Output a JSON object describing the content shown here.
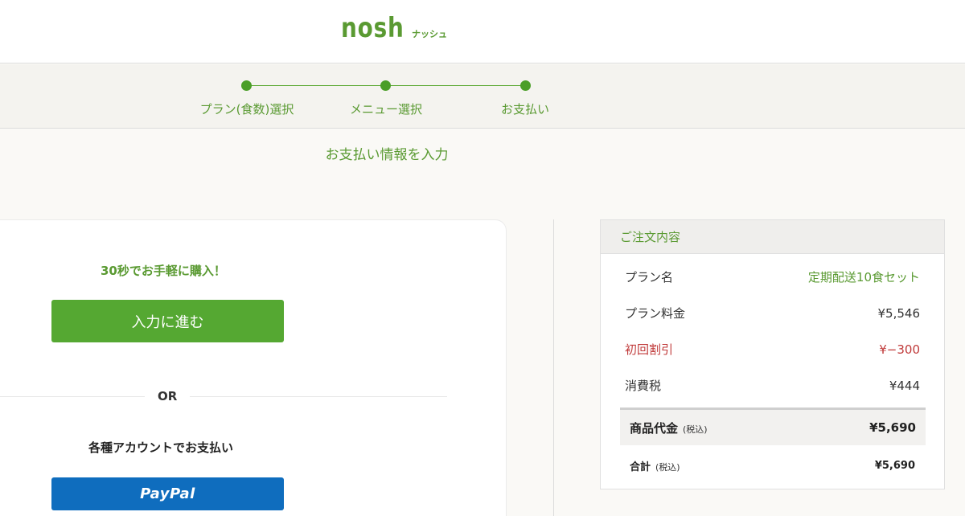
{
  "brand": {
    "logo_main": "nosh",
    "logo_sub": "ナッシュ"
  },
  "stepper": {
    "steps": [
      {
        "label": "プラン(食数)選択"
      },
      {
        "label": "メニュー選択"
      },
      {
        "label": "お支払い"
      }
    ]
  },
  "page_title": "お支払い情報を入力",
  "payment": {
    "quick_text": "30秒でお手軽に購入！",
    "proceed_label": "入力に進む",
    "or_label": "OR",
    "accounts_text": "各種アカウントでお支払い",
    "paypal_label": "PayPal"
  },
  "summary": {
    "heading": "ご注文内容",
    "rows": [
      {
        "label": "プラン名",
        "value": "定期配送10食セット"
      },
      {
        "label": "プラン料金",
        "value": "¥5,546"
      },
      {
        "label": "初回割引",
        "value": "¥−300"
      },
      {
        "label": "消費税",
        "value": "¥444"
      }
    ],
    "subtotal": {
      "label": "商品代金",
      "note": "(税込)",
      "value": "¥5,690"
    },
    "total": {
      "label": "合計",
      "note": "(税込)",
      "value": "¥5,690"
    }
  },
  "colors": {
    "brand_green": "#5a9a32",
    "button_green": "#55a832",
    "paypal_blue": "#0f6dbe",
    "discount_red": "#c03a3a"
  }
}
